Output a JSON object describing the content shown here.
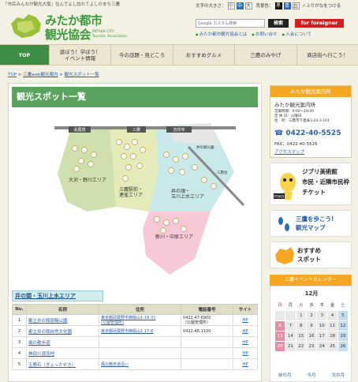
{
  "top_tagline": "「市民みんなが観光大使」住んでよし訪れてよしのまち三鷹",
  "logo": {
    "line1": "みたか都市",
    "line2": "観光協会",
    "en_line1": "MITAKA CITY",
    "en_line2": "Tourism Association"
  },
  "util": {
    "font_size_label": "文字の大きさ：",
    "sizes": [
      "小",
      "中",
      "大"
    ],
    "bg_label": "背景色：",
    "bg_colors": [
      "黒",
      "青",
      "白"
    ],
    "ruby": "ふりがなをつける"
  },
  "search": {
    "placeholder": "Google カスタム検索",
    "button": "検索"
  },
  "foreigner": "for foreigner",
  "header_links": [
    "みたか都市観光協会とは",
    "お問い合せ",
    "入会について"
  ],
  "nav": [
    "TOP",
    "遊ぼう！学ぼう！\nイベント情報",
    "今の話題・見どころ",
    "おすすめグルメ",
    "三鷹のみやげ",
    "商店街へ行こう！"
  ],
  "breadcrumb": {
    "home": "TOP",
    "sep": " > ",
    "l1": "三鷹web観光案内",
    "l2": "観光スポット一覧"
  },
  "main": {
    "title": "観光スポット一覧"
  },
  "map": {
    "stations": [
      "武蔵境",
      "三鷹",
      "吉祥寺",
      "井の頭公園"
    ],
    "areas": [
      "大沢・野川エリア",
      "三鷹駅前・\n連雀エリア",
      "井の頭・\n玉川上水エリア",
      "新川・中原エリア"
    ],
    "labels": [
      "三鷹台"
    ],
    "area_colors": {
      "osawa": "#cfe0ae",
      "renjaku": "#e4eab8",
      "inokashira": "#c9e8ea",
      "shinkawa": "#f7c9d6",
      "north": "#e6e6e6"
    }
  },
  "section": {
    "title": "井の頭・玉川上水エリア"
  },
  "table": {
    "headers": [
      "No.",
      "名称",
      "住所",
      "電話番号",
      "サイト"
    ],
    "rows": [
      {
        "no": "1",
        "name": "都立井の頭恩賜公園",
        "addr": "東京都武蔵野市御殿山1-18-31\n(公園管理所)",
        "tel": "0422-47-6900\n（公園管理所）",
        "site": "HP"
      },
      {
        "no": "2",
        "name": "都立井の頭自然文化園",
        "addr": "東京都武蔵野市御殿山1-17-6",
        "tel": "0422-46-1100",
        "site": "HP"
      },
      {
        "no": "3",
        "name": "風の散歩道",
        "addr": "",
        "tel": "",
        "site": "HP"
      },
      {
        "no": "4",
        "name": "神田川源流地",
        "addr": "",
        "tel": "",
        "site": "HP"
      },
      {
        "no": "5",
        "name": "玉鹿石（ぎょっかせき）",
        "addr": "風の散歩道沿い",
        "tel": "",
        "site": "HP"
      }
    ]
  },
  "info": {
    "head": "みたか観光案内所",
    "name": "みたか観光案内所",
    "hours": [
      "営業時間：9:00～18:00",
      "定 休 日：火曜日",
      "住　所：三鷹市下連雀3-24-3-101"
    ],
    "tel": "0422-40-5525",
    "fax": "FAX：0422-40-5526",
    "access": "アクセスマップ"
  },
  "banners": [
    {
      "lines": [
        "ジブリ美術館",
        "市民・近隣市民枠",
        "チケット"
      ],
      "tag": "POKO"
    },
    {
      "lines": [
        "三鷹を歩こう!",
        "観光マップ"
      ]
    },
    {
      "lines": [
        "おすすめ",
        "スポット"
      ]
    }
  ],
  "calendar": {
    "head": "三鷹イベントカレンダー",
    "month": "12月",
    "days": [
      "日",
      "月",
      "火",
      "水",
      "木",
      "金",
      "土"
    ],
    "dates": [
      "",
      "",
      "1",
      "2",
      "3",
      "4",
      "5",
      "6",
      "7",
      "8",
      "9",
      "10",
      "11",
      "12",
      "13",
      "14",
      "15",
      "16",
      "17",
      "18",
      "19",
      "20",
      "21",
      "22",
      "23",
      "24",
      "25",
      "26"
    ],
    "prev": "前の月",
    "today": "今月",
    "next": "次の月"
  }
}
